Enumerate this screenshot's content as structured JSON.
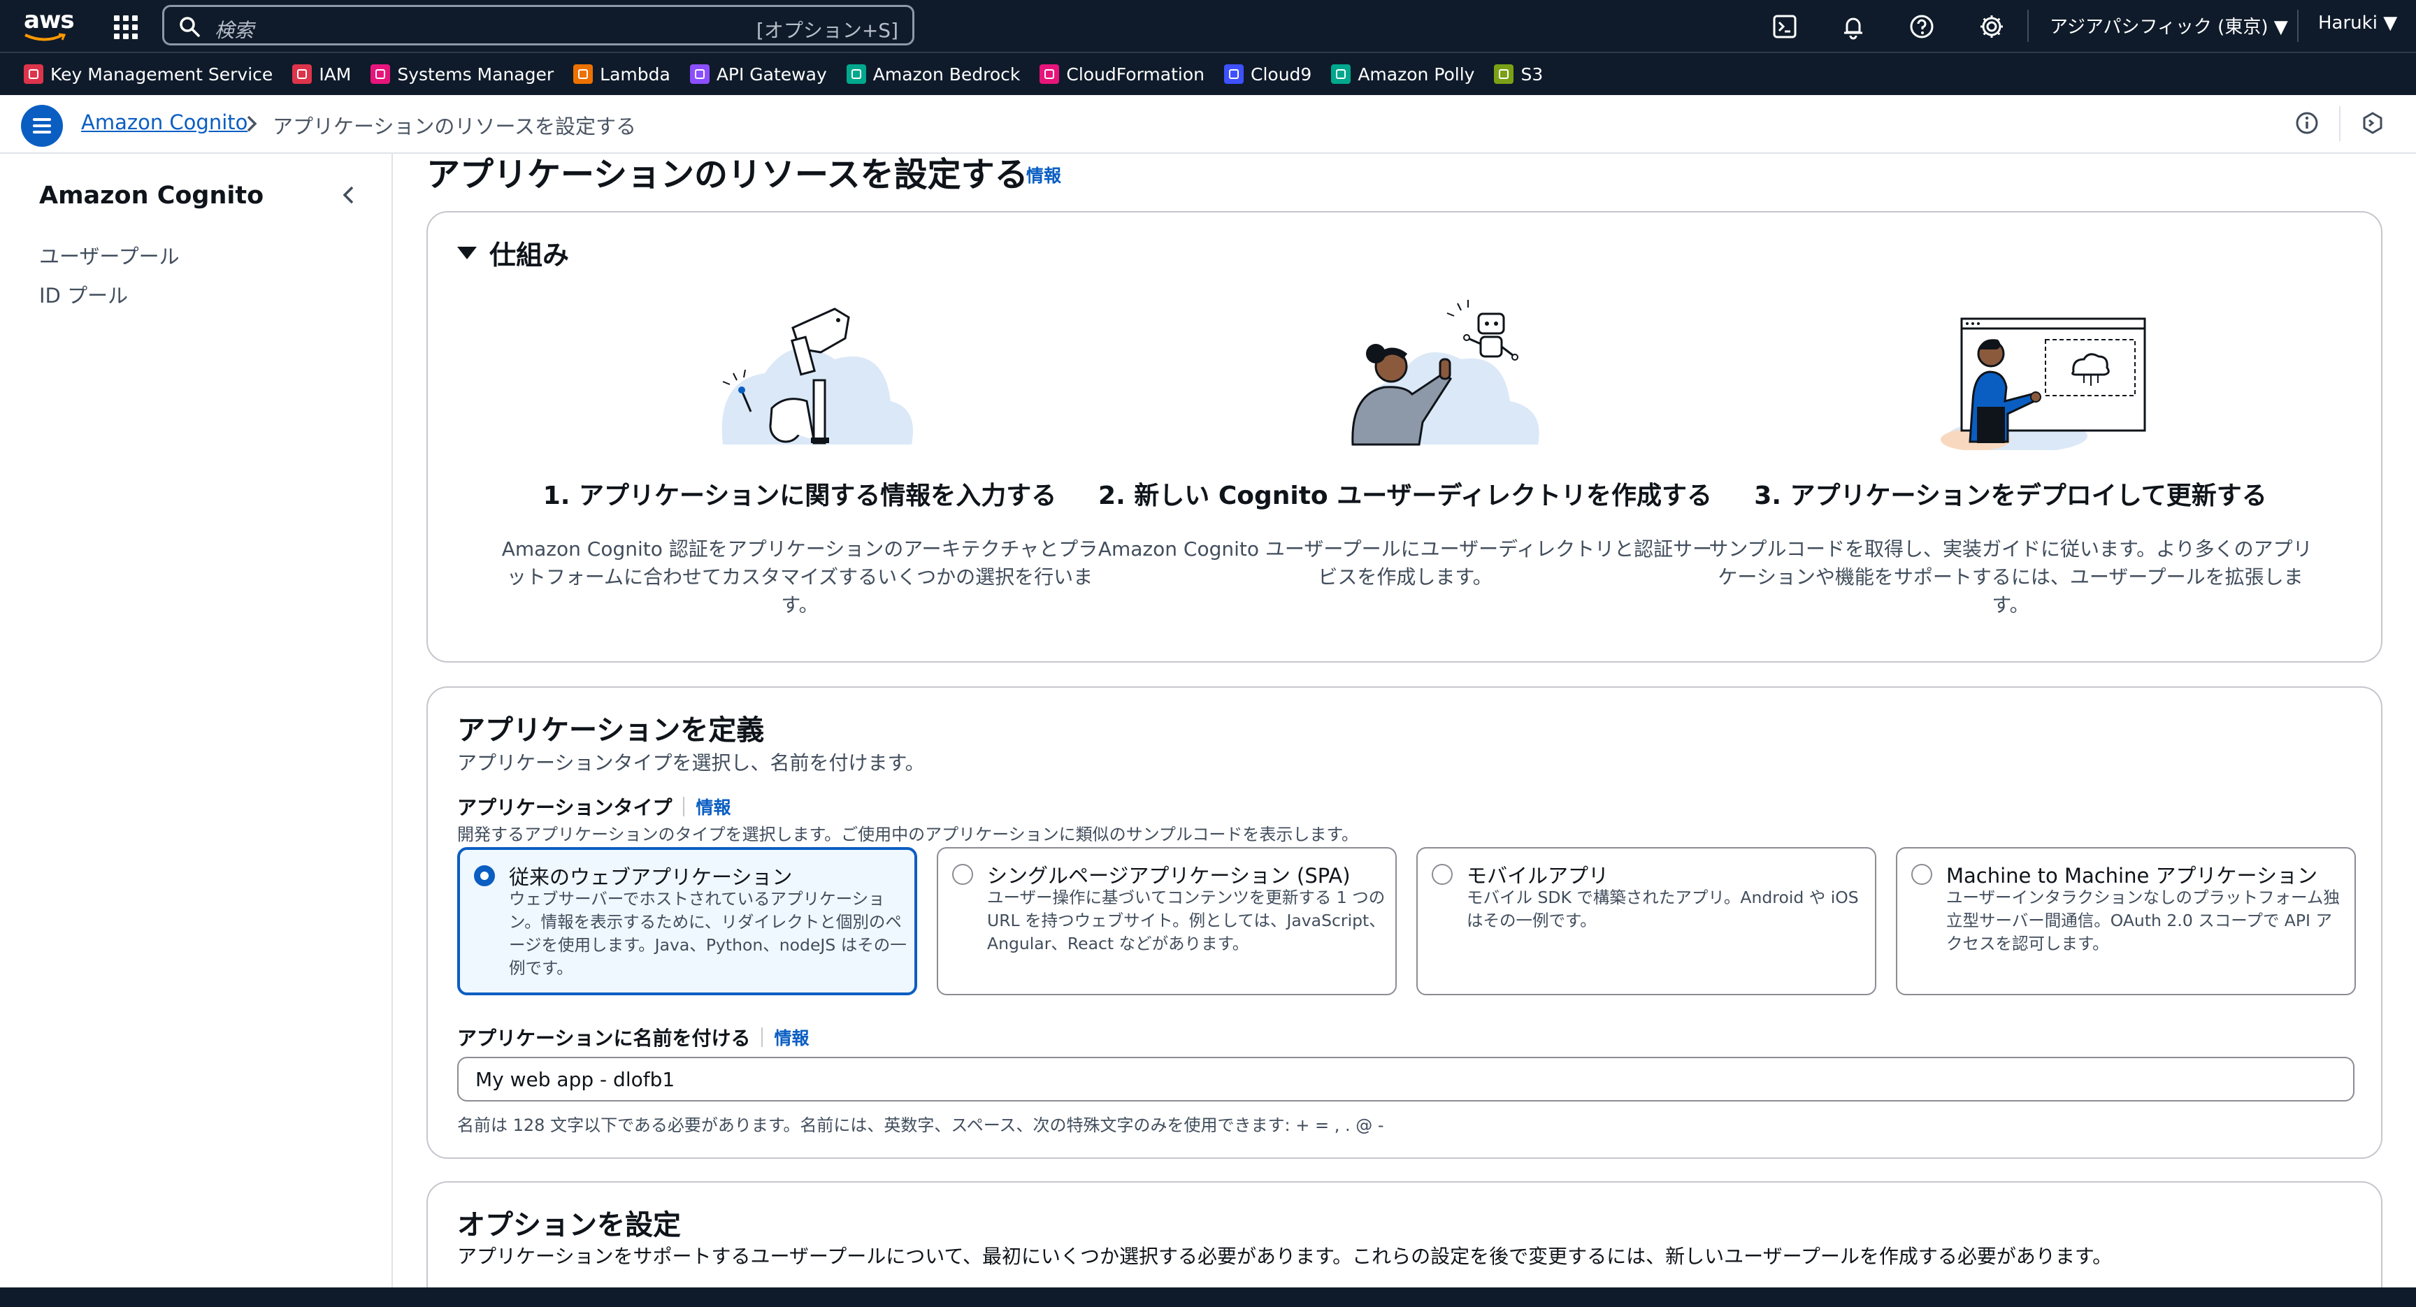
{
  "topnav": {
    "logo_text": "aws",
    "search_placeholder": "検索",
    "search_shortcut": "[オプション+S]",
    "region": "アジアパシフィック (東京) ▼",
    "user": "Haruki ▼"
  },
  "favorites": [
    {
      "label": "Key Management Service",
      "color": "#dd344c",
      "icon": "kms-icon"
    },
    {
      "label": "IAM",
      "color": "#dd344c",
      "icon": "iam-icon"
    },
    {
      "label": "Systems Manager",
      "color": "#e7157b",
      "icon": "systems-manager-icon"
    },
    {
      "label": "Lambda",
      "color": "#ed7100",
      "icon": "lambda-icon"
    },
    {
      "label": "API Gateway",
      "color": "#8c4fff",
      "icon": "api-gateway-icon"
    },
    {
      "label": "Amazon Bedrock",
      "color": "#01a88d",
      "icon": "bedrock-icon"
    },
    {
      "label": "CloudFormation",
      "color": "#e7157b",
      "icon": "cloudformation-icon"
    },
    {
      "label": "Cloud9",
      "color": "#3f51ff",
      "icon": "cloud9-icon"
    },
    {
      "label": "Amazon Polly",
      "color": "#01a88d",
      "icon": "polly-icon"
    },
    {
      "label": "S3",
      "color": "#7aa116",
      "icon": "s3-icon"
    }
  ],
  "breadcrumb": {
    "link": "Amazon Cognito",
    "current": "アプリケーションのリソースを設定する"
  },
  "sidebar": {
    "title": "Amazon Cognito",
    "items": [
      {
        "label": "ユーザープール"
      },
      {
        "label": "ID プール"
      }
    ]
  },
  "page": {
    "title": "アプリケーションのリソースを設定する",
    "info": "情報"
  },
  "how_it_works": {
    "toggle_label": "仕組み",
    "steps": [
      {
        "title": "1. アプリケーションに関する情報を入力する",
        "desc": "Amazon Cognito 認証をアプリケーションのアーキテクチャとプラットフォームに合わせてカスタマイズするいくつかの選択を行います。"
      },
      {
        "title": "2. 新しい Cognito ユーザーディレクトリを作成する",
        "desc": "Amazon Cognito ユーザープールにユーザーディレクトリと認証サービスを作成します。"
      },
      {
        "title": "3. アプリケーションをデプロイして更新する",
        "desc": "サンプルコードを取得し、実装ガイドに従います。より多くのアプリケーションや機能をサポートするには、ユーザープールを拡張します。"
      }
    ]
  },
  "define_app": {
    "title": "アプリケーションを定義",
    "subtitle": "アプリケーションタイプを選択し、名前を付けます。",
    "type_label": "アプリケーションタイプ",
    "type_info": "情報",
    "type_hint": "開発するアプリケーションのタイプを選択します。ご使用中のアプリケーションに類似のサンプルコードを表示します。",
    "types": [
      {
        "title": "従来のウェブアプリケーション",
        "desc": "ウェブサーバーでホストされているアプリケーション。情報を表示するために、リダイレクトと個別のページを使用します。Java、Python、nodeJS はその一例です。",
        "selected": true
      },
      {
        "title": "シングルページアプリケーション (SPA)",
        "desc": "ユーザー操作に基づいてコンテンツを更新する 1 つの URL を持つウェブサイト。例としては、JavaScript、Angular、React などがあります。",
        "selected": false
      },
      {
        "title": "モバイルアプリ",
        "desc": "モバイル SDK で構築されたアプリ。Android や iOS はその一例です。",
        "selected": false
      },
      {
        "title": "Machine to Machine アプリケーション",
        "desc": "ユーザーインタラクションなしのプラットフォーム独立型サーバー間通信。OAuth 2.0 スコープで API アクセスを認可します。",
        "selected": false
      }
    ],
    "name_label": "アプリケーションに名前を付ける",
    "name_info": "情報",
    "name_value": "My web app - dlofb1",
    "name_hint": "名前は 128 文字以下である必要があります。名前には、英数字、スペース、次の特殊文字のみを使用できます: + = , . @ -"
  },
  "options": {
    "title": "オプションを設定",
    "subtitle": "アプリケーションをサポートするユーザープールについて、最初にいくつか選択する必要があります。これらの設定を後で変更するには、新しいユーザープールを作成する必要があります。"
  }
}
